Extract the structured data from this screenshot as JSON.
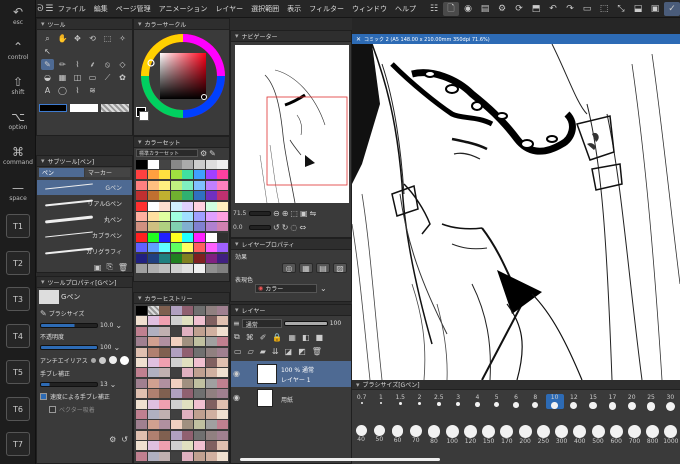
{
  "edge_keys": [
    {
      "icon": "↶",
      "label": "esc"
    },
    {
      "icon": "⌃",
      "label": "control"
    },
    {
      "icon": "⇧",
      "label": "shift"
    },
    {
      "icon": "⌥",
      "label": "option"
    },
    {
      "icon": "⌘",
      "label": "command"
    },
    {
      "icon": "—",
      "label": "space"
    }
  ],
  "touch_keys": [
    "T1",
    "T2",
    "T3",
    "T4",
    "T5",
    "T6",
    "T7"
  ],
  "menubar": {
    "logo_icon": "clip-logo-icon",
    "items": [
      "ファイル",
      "編集",
      "ページ管理",
      "アニメーション",
      "レイヤー",
      "選択範囲",
      "表示",
      "フィルター",
      "ウィンドウ",
      "ヘルプ"
    ]
  },
  "tool_panel": {
    "title": "ツール"
  },
  "color_circle_panel": {
    "title": "カラーサークル"
  },
  "navigator_panel": {
    "title": "ナビゲーター",
    "zoom": "71.5",
    "angle": "0.0"
  },
  "canvas_tab": {
    "title": "コミック 2 (A5 148.00 x 210.00mm 350dpi 71.6%)"
  },
  "subtool_panel": {
    "title": "サブツール[ペン]",
    "tabs": [
      "ペン",
      "マーカー"
    ],
    "brushes": [
      "Gペン",
      "リアルGペン",
      "丸ペン",
      "カブラペン",
      "カリグラフィ"
    ]
  },
  "color_set_panel": {
    "title": "カラーセット",
    "set_name": "標準カラーセット"
  },
  "color_history_panel": {
    "title": "カラーヒストリー"
  },
  "layer_property_panel": {
    "title": "レイヤープロパティ",
    "effect_label": "効果",
    "expression_label": "表現色",
    "expression_value": "カラー"
  },
  "layer_panel": {
    "title": "レイヤー",
    "blend_mode": "通常",
    "opacity": "100",
    "layers": [
      {
        "mode": "100 % 通常",
        "name": "レイヤー 1"
      },
      {
        "mode": "",
        "name": "用紙"
      }
    ]
  },
  "tool_property_panel": {
    "title": "ツールプロパティ[Gペン]",
    "brush_name": "Gペン",
    "brush_size_label": "ブラシサイズ",
    "brush_size_value": "10.0",
    "opacity_label": "不透明度",
    "opacity_value": "100",
    "antialias_label": "アンチエイリアス",
    "stabilization_label": "手ブレ補正",
    "stabilization_value": "13",
    "speed_label": "速度による手ブレ補正",
    "vector_label": "ベクター吸着"
  },
  "brush_size_panel": {
    "title": "ブラシサイズ[Gペン]",
    "row1": [
      "0.7",
      "1",
      "1.5",
      "2",
      "2.5",
      "3",
      "4",
      "5",
      "6",
      "8",
      "10",
      "12",
      "15",
      "17",
      "20",
      "25",
      "30"
    ],
    "row2": [
      "40",
      "50",
      "60",
      "70",
      "80",
      "100",
      "120",
      "150",
      "170",
      "200",
      "250",
      "300",
      "400",
      "500",
      "600",
      "700",
      "800",
      "1000"
    ],
    "selected": "10"
  },
  "colors": {
    "panel_bg": "#3a3a3a",
    "header_bg": "#2e2e2e",
    "accent": "#2d6bb5",
    "main_color": "#000000"
  }
}
